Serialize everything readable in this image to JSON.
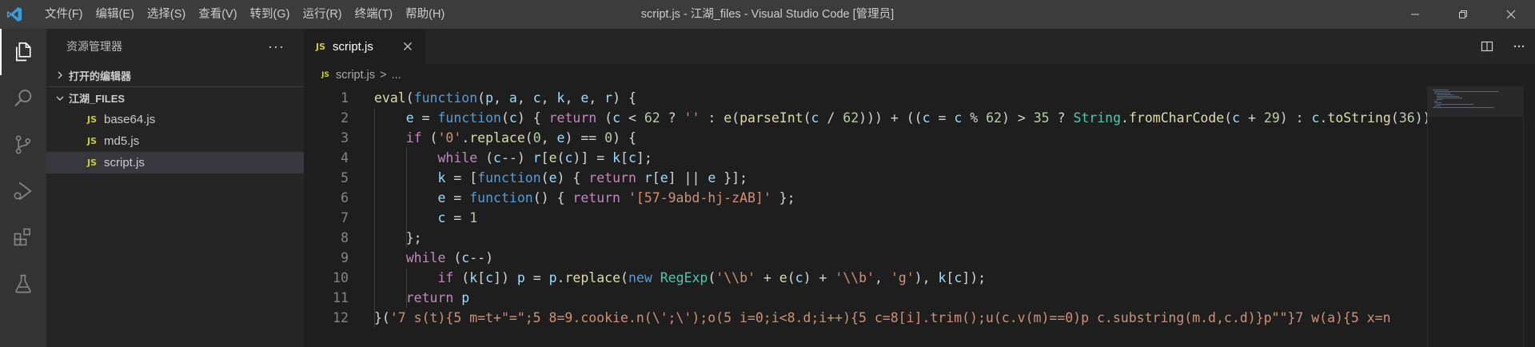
{
  "titlebar": {
    "menu": [
      "文件(F)",
      "编辑(E)",
      "选择(S)",
      "查看(V)",
      "转到(G)",
      "运行(R)",
      "终端(T)",
      "帮助(H)"
    ],
    "title": "script.js - 江湖_files - Visual Studio Code [管理员]"
  },
  "sidebar": {
    "header": "资源管理器",
    "more": "···",
    "open_editors": "打开的编辑器",
    "folder": "江湖_FILES",
    "files": [
      {
        "name": "base64.js",
        "badge": "JS"
      },
      {
        "name": "md5.js",
        "badge": "JS"
      },
      {
        "name": "script.js",
        "badge": "JS"
      }
    ]
  },
  "editor": {
    "tab_label": "script.js",
    "tab_badge": "JS",
    "breadcrumb_file": "script.js",
    "breadcrumb_sep": ">",
    "breadcrumb_more": "...",
    "split_icon": "split-editor-icon",
    "more_icon": "more-actions-icon",
    "line_numbers": [
      "1",
      "2",
      "3",
      "4",
      "5",
      "6",
      "7",
      "8",
      "9",
      "10",
      "11",
      "12"
    ]
  },
  "colors": {
    "keyword": "#569cd6",
    "control": "#c586c0",
    "string": "#ce9178",
    "function": "#dcdcaa",
    "variable": "#9cdcfe",
    "number": "#b5cea8",
    "type": "#4ec9b0",
    "plain": "#d4d4d4"
  },
  "code_lines": [
    [
      [
        "eval",
        "fn"
      ],
      [
        "(",
        "p"
      ],
      [
        "function",
        "kw"
      ],
      [
        "(",
        "p"
      ],
      [
        "p",
        "var"
      ],
      [
        ", ",
        "p"
      ],
      [
        "a",
        "var"
      ],
      [
        ", ",
        "p"
      ],
      [
        "c",
        "var"
      ],
      [
        ", ",
        "p"
      ],
      [
        "k",
        "var"
      ],
      [
        ", ",
        "p"
      ],
      [
        "e",
        "var"
      ],
      [
        ", ",
        "p"
      ],
      [
        "r",
        "var"
      ],
      [
        ") {",
        "p"
      ]
    ],
    [
      [
        "    ",
        "p"
      ],
      [
        "e",
        "var"
      ],
      [
        " = ",
        "p"
      ],
      [
        "function",
        "kw"
      ],
      [
        "(",
        "p"
      ],
      [
        "c",
        "var"
      ],
      [
        ") { ",
        "p"
      ],
      [
        "return",
        "ctl"
      ],
      [
        " (",
        "p"
      ],
      [
        "c",
        "var"
      ],
      [
        " < ",
        "p"
      ],
      [
        "62",
        "num"
      ],
      [
        " ? ",
        "p"
      ],
      [
        "''",
        "str"
      ],
      [
        " : ",
        "p"
      ],
      [
        "e",
        "fn"
      ],
      [
        "(",
        "p"
      ],
      [
        "parseInt",
        "fn"
      ],
      [
        "(",
        "p"
      ],
      [
        "c",
        "var"
      ],
      [
        " / ",
        "p"
      ],
      [
        "62",
        "num"
      ],
      [
        "))) + ((",
        "p"
      ],
      [
        "c",
        "var"
      ],
      [
        " = ",
        "p"
      ],
      [
        "c",
        "var"
      ],
      [
        " % ",
        "p"
      ],
      [
        "62",
        "num"
      ],
      [
        ") > ",
        "p"
      ],
      [
        "35",
        "num"
      ],
      [
        " ? ",
        "p"
      ],
      [
        "String",
        "type"
      ],
      [
        ".",
        "p"
      ],
      [
        "fromCharCode",
        "fn"
      ],
      [
        "(",
        "p"
      ],
      [
        "c",
        "var"
      ],
      [
        " + ",
        "p"
      ],
      [
        "29",
        "num"
      ],
      [
        ") : ",
        "p"
      ],
      [
        "c",
        "var"
      ],
      [
        ".",
        "p"
      ],
      [
        "toString",
        "fn"
      ],
      [
        "(",
        "p"
      ],
      [
        "36",
        "num"
      ],
      [
        "))",
        "p"
      ]
    ],
    [
      [
        "    ",
        "p"
      ],
      [
        "if",
        "ctl"
      ],
      [
        " (",
        "p"
      ],
      [
        "'0'",
        "str"
      ],
      [
        ".",
        "p"
      ],
      [
        "replace",
        "fn"
      ],
      [
        "(",
        "p"
      ],
      [
        "0",
        "num"
      ],
      [
        ", ",
        "p"
      ],
      [
        "e",
        "var"
      ],
      [
        ") == ",
        "p"
      ],
      [
        "0",
        "num"
      ],
      [
        ") {",
        "p"
      ]
    ],
    [
      [
        "        ",
        "p"
      ],
      [
        "while",
        "ctl"
      ],
      [
        " (",
        "p"
      ],
      [
        "c",
        "var"
      ],
      [
        "--) ",
        "p"
      ],
      [
        "r",
        "var"
      ],
      [
        "[",
        "p"
      ],
      [
        "e",
        "fn"
      ],
      [
        "(",
        "p"
      ],
      [
        "c",
        "var"
      ],
      [
        ")] = ",
        "p"
      ],
      [
        "k",
        "var"
      ],
      [
        "[",
        "p"
      ],
      [
        "c",
        "var"
      ],
      [
        "];",
        "p"
      ]
    ],
    [
      [
        "        ",
        "p"
      ],
      [
        "k",
        "var"
      ],
      [
        " = [",
        "p"
      ],
      [
        "function",
        "kw"
      ],
      [
        "(",
        "p"
      ],
      [
        "e",
        "var"
      ],
      [
        ") { ",
        "p"
      ],
      [
        "return",
        "ctl"
      ],
      [
        " ",
        "p"
      ],
      [
        "r",
        "var"
      ],
      [
        "[",
        "p"
      ],
      [
        "e",
        "var"
      ],
      [
        "] || ",
        "p"
      ],
      [
        "e",
        "var"
      ],
      [
        " }];",
        "p"
      ]
    ],
    [
      [
        "        ",
        "p"
      ],
      [
        "e",
        "var"
      ],
      [
        " = ",
        "p"
      ],
      [
        "function",
        "kw"
      ],
      [
        "() { ",
        "p"
      ],
      [
        "return",
        "ctl"
      ],
      [
        " ",
        "p"
      ],
      [
        "'[57-9abd-hj-zAB]'",
        "str"
      ],
      [
        " };",
        "p"
      ]
    ],
    [
      [
        "        ",
        "p"
      ],
      [
        "c",
        "var"
      ],
      [
        " = ",
        "p"
      ],
      [
        "1",
        "num"
      ]
    ],
    [
      [
        "    ",
        "p"
      ],
      [
        "};",
        "p"
      ]
    ],
    [
      [
        "    ",
        "p"
      ],
      [
        "while",
        "ctl"
      ],
      [
        " (",
        "p"
      ],
      [
        "c",
        "var"
      ],
      [
        "--)",
        "p"
      ]
    ],
    [
      [
        "        ",
        "p"
      ],
      [
        "if",
        "ctl"
      ],
      [
        " (",
        "p"
      ],
      [
        "k",
        "var"
      ],
      [
        "[",
        "p"
      ],
      [
        "c",
        "var"
      ],
      [
        "]) ",
        "p"
      ],
      [
        "p",
        "var"
      ],
      [
        " = ",
        "p"
      ],
      [
        "p",
        "var"
      ],
      [
        ".",
        "p"
      ],
      [
        "replace",
        "fn"
      ],
      [
        "(",
        "p"
      ],
      [
        "new",
        "kw"
      ],
      [
        " ",
        "p"
      ],
      [
        "RegExp",
        "type"
      ],
      [
        "(",
        "p"
      ],
      [
        "'\\\\b'",
        "str"
      ],
      [
        " + ",
        "p"
      ],
      [
        "e",
        "fn"
      ],
      [
        "(",
        "p"
      ],
      [
        "c",
        "var"
      ],
      [
        ") + ",
        "p"
      ],
      [
        "'\\\\b'",
        "str"
      ],
      [
        ", ",
        "p"
      ],
      [
        "'g'",
        "str"
      ],
      [
        "), ",
        "p"
      ],
      [
        "k",
        "var"
      ],
      [
        "[",
        "p"
      ],
      [
        "c",
        "var"
      ],
      [
        "]);",
        "p"
      ]
    ],
    [
      [
        "    ",
        "p"
      ],
      [
        "return",
        "ctl"
      ],
      [
        " ",
        "p"
      ],
      [
        "p",
        "var"
      ]
    ],
    [
      [
        "}(",
        "p"
      ],
      [
        "'7 s(t){5 m=t+\"=\";5 8=9.cookie.n(\\';\\');o(5 i=0;i<8.d;i++){5 c=8[i].trim();u(c.v(m)==0)p c.substring(m.d,c.d)}p\"\"}7 w(a){5 x=n",
        "str"
      ]
    ]
  ]
}
